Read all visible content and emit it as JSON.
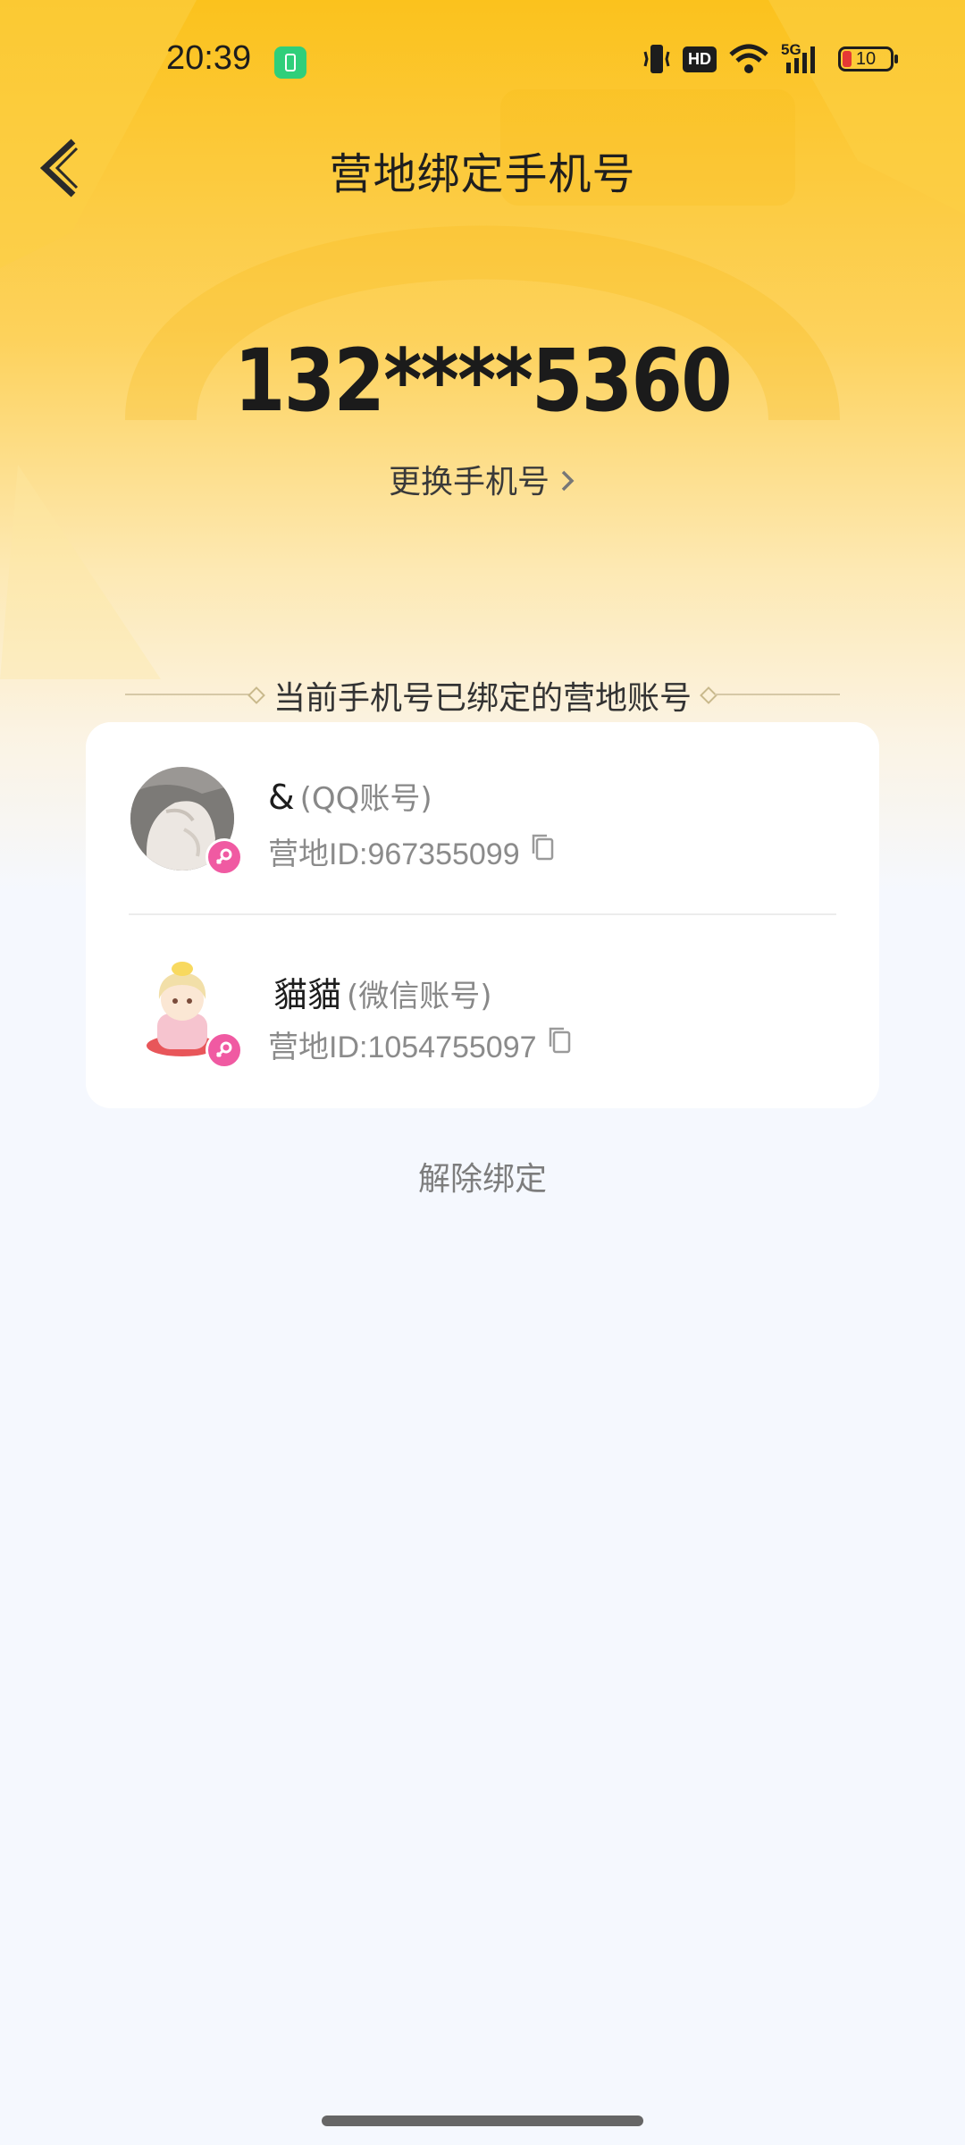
{
  "status_bar": {
    "time": "20:39",
    "hd_label": "HD",
    "network_label": "5G",
    "battery_level": "10",
    "icons": [
      "battery-saver-icon",
      "vibrate-icon",
      "hd-icon",
      "wifi-icon",
      "signal-icon",
      "battery-icon"
    ]
  },
  "header": {
    "title": "营地绑定手机号",
    "back_icon": "chevron-left-icon"
  },
  "phone": {
    "number": "132****5360",
    "change_label": "更换手机号"
  },
  "section": {
    "title": "当前手机号已绑定的营地账号"
  },
  "accounts": [
    {
      "name": "&",
      "type": "(QQ账号)",
      "id_label": "营地ID:967355099",
      "gender": "female"
    },
    {
      "name": "貓貓",
      "type": "(微信账号)",
      "id_label": "营地ID:1054755097",
      "gender": "female"
    }
  ],
  "actions": {
    "unbind_label": "解除绑定"
  },
  "colors": {
    "accent_yellow": "#fbc21d",
    "badge_pink": "#f05aa2",
    "page_bg": "#f5f8fe"
  }
}
